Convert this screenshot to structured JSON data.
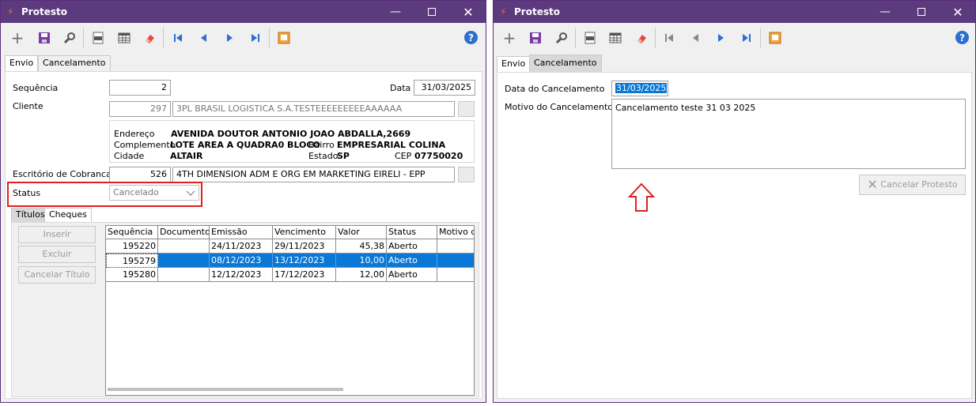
{
  "left_window": {
    "title": "Protesto",
    "tabs": [
      "Envio",
      "Cancelamento"
    ],
    "fields": {
      "sequencia_label": "Sequência",
      "sequencia_value": "2",
      "data_label": "Data",
      "data_value": "31/03/2025",
      "cliente_label": "Cliente",
      "cliente_code": "297",
      "cliente_name": "3PL BRASIL LOGISTICA S.A.TESTEEEEEEEEEAAAAAA",
      "endereco_label": "Endereço",
      "endereco_value": "AVENIDA DOUTOR ANTONIO JOAO ABDALLA,2669",
      "complemento_label": "Complemento",
      "complemento_value": "LOTE AREA A QUADRA0 BLOCO",
      "bairro_label": "Bairro",
      "bairro_value": "EMPRESARIAL COLINA",
      "cidade_label": "Cidade",
      "cidade_value": "ALTAIR",
      "estado_label": "Estado",
      "estado_value": "SP",
      "cep_label": "CEP",
      "cep_value": "07750020",
      "escritorio_label": "Escritório de Cobranca",
      "escritorio_code": "526",
      "escritorio_name": "4TH DIMENSION ADM E ORG EM MARKETING EIRELI - EPP",
      "status_label": "Status",
      "status_value": "Cancelado"
    },
    "subtabs": [
      "Títulos",
      "Cheques"
    ],
    "buttons": {
      "inserir": "Inserir",
      "excluir": "Excluir",
      "cancelar_titulo": "Cancelar Título"
    },
    "grid": {
      "columns": [
        "Sequência",
        "Documento",
        "Emissão",
        "Vencimento",
        "Valor",
        "Status",
        "Motivo do"
      ],
      "rows": [
        [
          "195220",
          "",
          "24/11/2023",
          "29/11/2023",
          "45,38",
          "Aberto",
          ""
        ],
        [
          "195279",
          "",
          "08/12/2023",
          "13/12/2023",
          "10,00",
          "Aberto",
          ""
        ],
        [
          "195280",
          "",
          "12/12/2023",
          "17/12/2023",
          "12,00",
          "Aberto",
          ""
        ]
      ]
    }
  },
  "right_window": {
    "title": "Protesto",
    "tabs": [
      "Envio",
      "Cancelamento"
    ],
    "data_cancelamento_label": "Data do Cancelamento",
    "data_cancelamento_value": "31/03/2025",
    "motivo_label": "Motivo do Cancelamento",
    "motivo_value": "Cancelamento teste 31 03 2025",
    "cancelar_protesto": "Cancelar Protesto"
  },
  "colors": {
    "titlebar": "#5b3a7e",
    "selection": "#0a78d7",
    "highlight": "#e02020",
    "help": "#2b6fd0"
  }
}
